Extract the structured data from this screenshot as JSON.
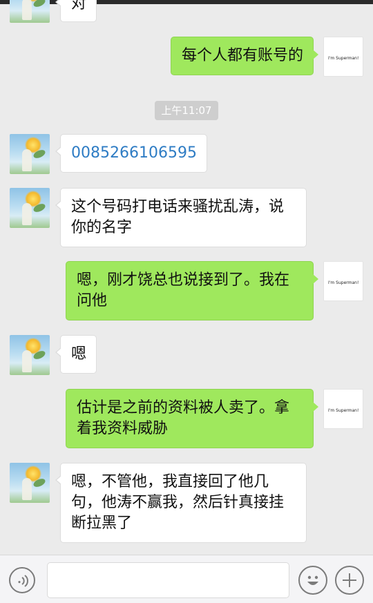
{
  "chat": {
    "timestamp": "上午11:07",
    "messages": [
      {
        "side": "in",
        "text": "对"
      },
      {
        "side": "out",
        "text": "每个人都有账号的"
      },
      {
        "side": "in",
        "text": "0085266106595"
      },
      {
        "side": "in",
        "text": "这个号码打电话来骚扰乱涛，说你的名字"
      },
      {
        "side": "out",
        "text": "嗯，刚才饶总也说接到了。我在问他"
      },
      {
        "side": "in",
        "text": "嗯"
      },
      {
        "side": "out",
        "text": "估计是之前的资料被人卖了。拿着我资料威胁"
      },
      {
        "side": "in",
        "text": "嗯，不管他，我直接回了他几句，他涛不赢我，然后针真接挂断拉黑了"
      }
    ],
    "self_avatar_text": "I'm Superman!"
  },
  "input_bar": {
    "voice_icon": "voice-icon",
    "emoji_icon": "emoji-icon",
    "plus_icon": "plus-icon",
    "input_value": ""
  },
  "colors": {
    "background": "#ebebeb",
    "outgoing_bubble": "#9fe85d",
    "incoming_bubble": "#ffffff",
    "phone_link": "#2e7cc4",
    "timestamp_bg": "#cecece"
  }
}
